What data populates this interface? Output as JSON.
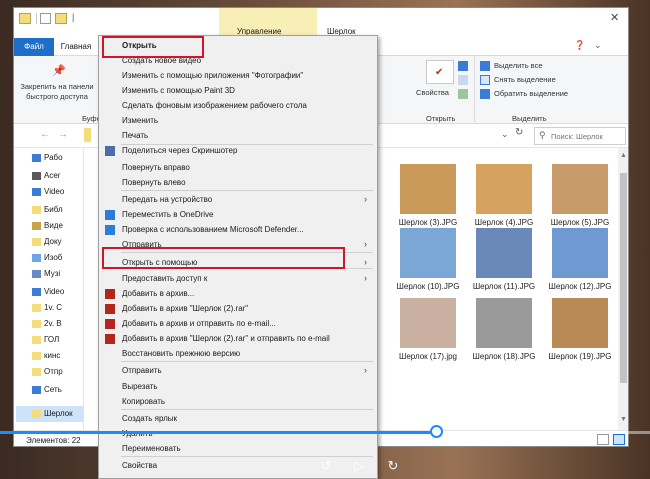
{
  "window": {
    "tab_file": "Файл",
    "tab_home": "Главная",
    "context_tab_manage": "Управление",
    "context_tab_folder": "Шерлок",
    "ribbon": {
      "pin_label": "Закрепить на панели быстрого доступа",
      "clipboard_group_partial": "Буфер",
      "properties_label": "Свойства",
      "open_group": "Открыть",
      "select_all": "Выделить все",
      "deselect": "Снять выделение",
      "invert_selection": "Обратить выделение",
      "select_group": "Выделить"
    },
    "search_placeholder": "Поиск: Шерлок",
    "nav_items": [
      "Рабо",
      "Acer",
      "Video",
      "Библ",
      "Виде",
      "Доку",
      "Изоб",
      "Музі",
      "Video",
      "1v. C",
      "2v. B",
      "ГОЛ",
      "кинс",
      "Отпр",
      "Сеть",
      "Шерлок"
    ],
    "status_count": "Элементов: 22",
    "files": [
      "Шерлок (3).JPG",
      "Шерлок (4).JPG",
      "Шерлок (5).JPG",
      "Шерлок (10).JPG",
      "Шерлок (11).JPG",
      "Шерлок (12).JPG",
      "Шерлок (17).jpg",
      "Шерлок (18).JPG",
      "Шерлок (19).JPG"
    ]
  },
  "context_menu": {
    "items": [
      "Открыть",
      "Создать новое видео",
      "Изменить с помощью приложения \"Фотографии\"",
      "Изменить с помощью Paint 3D",
      "Сделать фоновым изображением рабочего стола",
      "Изменить",
      "Печать",
      "Поделиться через Скриншотер",
      "Повернуть вправо",
      "Повернуть влево",
      "Передать на устройство",
      "Переместить в OneDrive",
      "Проверка с использованием Microsoft Defender...",
      "Отправить",
      "Открыть с помощью",
      "Предоставить доступ к",
      "Добавить в архив...",
      "Добавить в архив \"Шерлок (2).rar\"",
      "Добавить в архив и отправить по e-mail...",
      "Добавить в архив \"Шерлок (2).rar\" и отправить по e-mail",
      "Восстановить прежнюю версию",
      "Отправить",
      "Вырезать",
      "Копировать",
      "Создать ярлык",
      "Удалить",
      "Переименовать",
      "Свойства"
    ]
  },
  "player": {
    "progress": 0.67,
    "rewind_icon": "rewind-10-icon",
    "play_icon": "play-icon",
    "forward_icon": "forward-30-icon"
  },
  "colors": {
    "file_tab": "#1e6fc9",
    "manage_tab": "#f7efb5",
    "highlight": "#d0162a",
    "progress": "#1a8cff"
  }
}
